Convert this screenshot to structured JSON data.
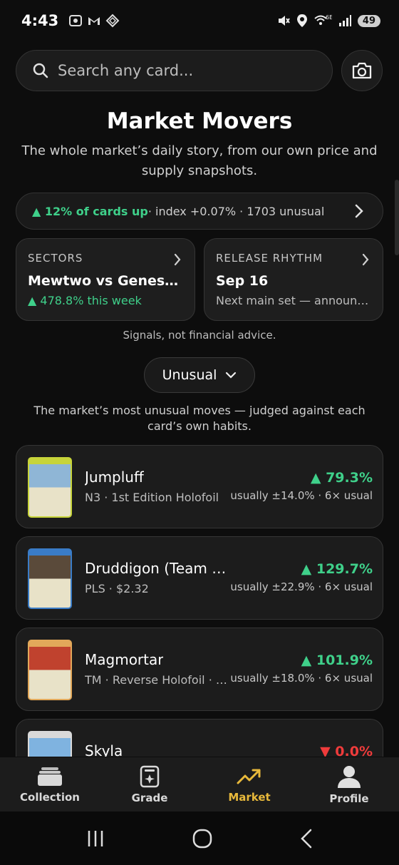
{
  "status_bar": {
    "time": "4:43",
    "network": "6E",
    "battery": "49"
  },
  "search": {
    "placeholder": "Search any card..."
  },
  "header": {
    "title": "Market Movers",
    "subtitle": "The whole market’s daily story, from our own price and supply snapshots."
  },
  "pulse": {
    "up_text": "▲ 12% of cards up",
    "index_text": " · index +0.07% · 1703 unusual"
  },
  "tiles": {
    "sectors": {
      "label": "SECTORS",
      "main": "Mewtwo vs Genesect",
      "sub": "▲ 478.8% this week"
    },
    "rhythm": {
      "label": "RELEASE RHYTHM",
      "main": "Sep 16",
      "sub": "Next main set — announced"
    }
  },
  "disclaimer": "Signals, not financial advice.",
  "filter": {
    "selected": "Unusual"
  },
  "filter_description": "The market’s most unusual moves — judged against each card’s own habits.",
  "movers": [
    {
      "name": "Jumpluff",
      "meta": "N3 · 1st Edition Holofoil",
      "change": "▲ 79.3%",
      "direction": "up",
      "usual": "usually ±14.0% · 6× usual",
      "thumb_color": "#c7d43a",
      "thumb_art": "#8fb6d6"
    },
    {
      "name": "Druddigon (Team Plasma)",
      "meta": "PLS · $2.32",
      "change": "▲ 129.7%",
      "direction": "up",
      "usual": "usually ±22.9% · 6× usual",
      "thumb_color": "#3a7cc7",
      "thumb_art": "#5a4a3a"
    },
    {
      "name": "Magmortar",
      "meta": "TM · Reverse Holofoil · Uncommon",
      "change": "▲ 101.9%",
      "direction": "up",
      "usual": "usually ±18.0% · 6× usual",
      "thumb_color": "#e2a85a",
      "thumb_art": "#c0422e"
    },
    {
      "name": "Skyla",
      "meta": "",
      "change": "▼ 0.0%",
      "direction": "down",
      "usual": "",
      "thumb_color": "#d9d9d9",
      "thumb_art": "#7fb3e0"
    }
  ],
  "nav": {
    "collection": "Collection",
    "grade": "Grade",
    "market": "Market",
    "profile": "Profile"
  },
  "colors": {
    "up": "#3fd08a",
    "down": "#ef3b3b",
    "accent": "#e8b93b"
  }
}
